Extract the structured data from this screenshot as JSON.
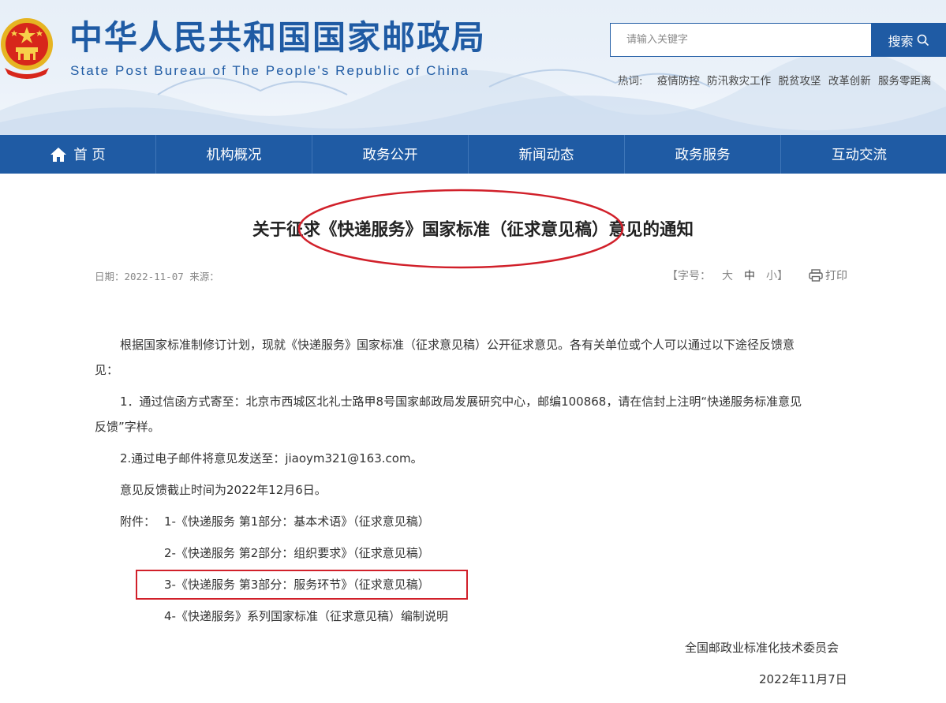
{
  "header": {
    "title": "中华人民共和国国家邮政局",
    "subtitle": "State Post Bureau of The People's Republic of China",
    "search": {
      "placeholder": "请输入关键字",
      "button": "搜索"
    },
    "hot": {
      "label": "热词:",
      "items": [
        "疫情防控",
        "防汛救灾工作",
        "脱贫攻坚",
        "改革创新",
        "服务零距离"
      ]
    }
  },
  "nav": {
    "items": [
      {
        "label": "首 页",
        "icon": "home-icon"
      },
      {
        "label": "机构概况"
      },
      {
        "label": "政务公开"
      },
      {
        "label": "新闻动态"
      },
      {
        "label": "政务服务"
      },
      {
        "label": "互动交流"
      }
    ]
  },
  "article": {
    "title": "关于征求《快递服务》国家标准（征求意见稿）意见的通知",
    "meta": "日期：2022-11-07 来源：",
    "fontsize": {
      "open": "【字号：",
      "large": "大",
      "medium": "中",
      "small": "小】",
      "print": "打印"
    },
    "p1_line1": "根据国家标准制修订计划，现就《快递服务》国家标准（征求意见稿）公开征求意见。各有关单位或个人可以通过以下途径反馈意",
    "p1_line2": "见：",
    "p2_line1": "1．通过信函方式寄至：北京市西城区北礼士路甲8号国家邮政局发展研究中心，邮编100868，请在信封上注明“快递服务标准意见",
    "p2_line2": "反馈”字样。",
    "p3": "2.通过电子邮件将意见发送至：jiaoym321@163.com。",
    "p4": "意见反馈截止时间为2022年12月6日。",
    "attachments_label": "附件：",
    "attachments": [
      "1-《快递服务 第1部分：基本术语》（征求意见稿）",
      "2-《快递服务 第2部分：组织要求》（征求意见稿）",
      "3-《快递服务 第3部分：服务环节》（征求意见稿）",
      "4-《快递服务》系列国家标准（征求意见稿）编制说明"
    ],
    "signature": "全国邮政业标准化技术委员会",
    "date": "2022年11月7日"
  },
  "colors": {
    "brand_blue": "#1f5ba4",
    "annotation_red": "#d1202a"
  }
}
